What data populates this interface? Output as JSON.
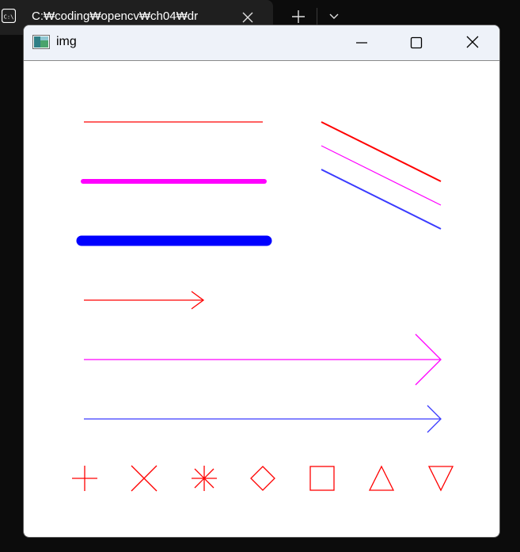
{
  "terminal": {
    "tab_icon": "terminal-icon",
    "tab_title": "C:₩coding₩opencv₩ch04₩dr",
    "close_icon": "close-icon",
    "new_tab_icon": "plus-icon",
    "dropdown_icon": "chevron-down-icon"
  },
  "window": {
    "title": "img",
    "app_icon": "image-window-icon",
    "controls": [
      "minimize-icon",
      "maximize-icon",
      "close-icon"
    ]
  },
  "colors": {
    "red": "#ff0000",
    "magenta": "#ff00ff",
    "blue": "#0000ff",
    "titlebar_bg": "#eef2f9",
    "tab_bg": "#1f1f1f",
    "terminal_bg": "#0c0c0c"
  },
  "canvas_content": {
    "lines": [
      "red-thin-line",
      "magenta-thick-line",
      "blue-thicker-line"
    ],
    "diagonal_lines": [
      "red-diagonal-line",
      "magenta-diagonal-line",
      "blue-diagonal-line"
    ],
    "arrows": [
      "red-short-arrow",
      "magenta-long-arrow",
      "blue-long-arrow"
    ],
    "markers": [
      "cross-marker",
      "tilted-cross-marker",
      "star-marker",
      "diamond-marker",
      "square-marker",
      "triangle-up-marker",
      "triangle-down-marker"
    ]
  }
}
